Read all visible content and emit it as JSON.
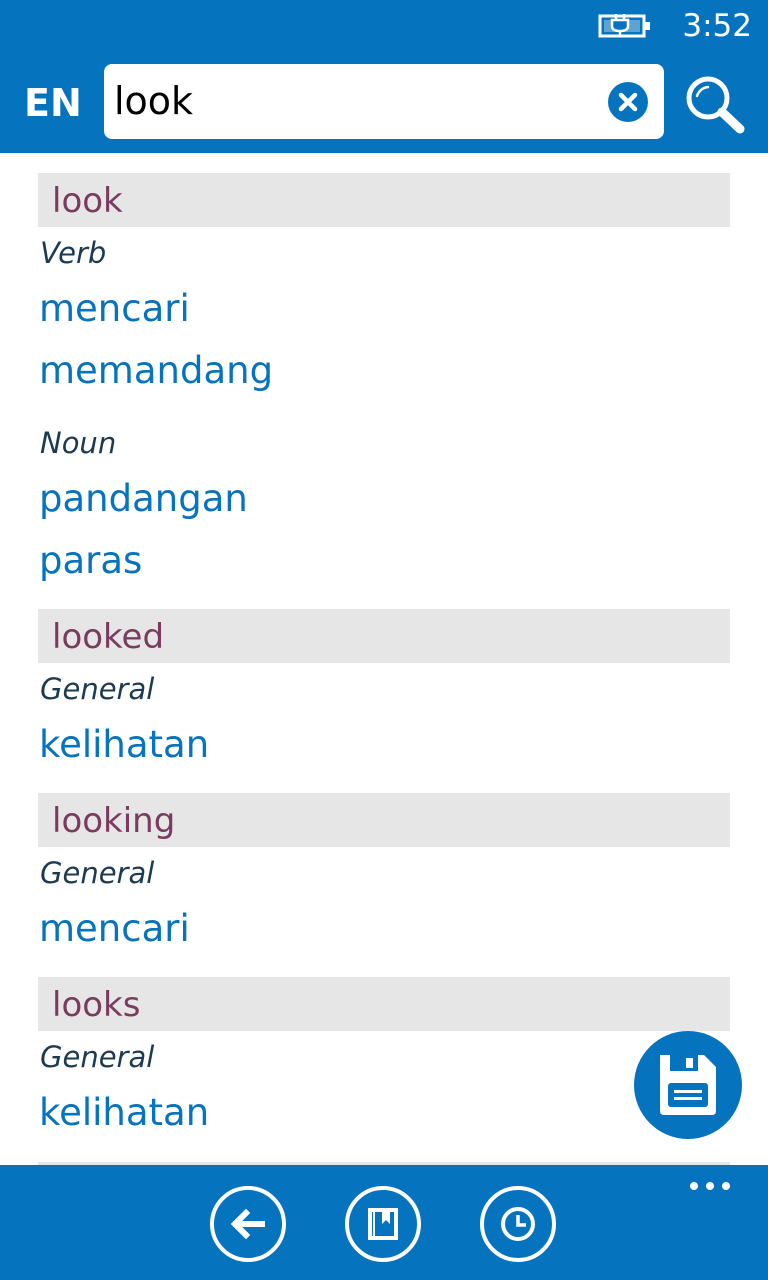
{
  "status_bar": {
    "time": "3:52",
    "battery_icon": "battery-charging-icon"
  },
  "header": {
    "language": "EN",
    "search": {
      "value": "look",
      "clear_icon": "clear-icon",
      "search_icon": "search-icon"
    }
  },
  "entries": [
    {
      "word": "look",
      "groups": [
        {
          "pos": "Verb",
          "translations": [
            "mencari",
            "memandang"
          ]
        },
        {
          "pos": "Noun",
          "translations": [
            "pandangan",
            "paras"
          ]
        }
      ]
    },
    {
      "word": "looked",
      "groups": [
        {
          "pos": "General",
          "translations": [
            "kelihatan"
          ]
        }
      ]
    },
    {
      "word": "looking",
      "groups": [
        {
          "pos": "General",
          "translations": [
            "mencari"
          ]
        }
      ]
    },
    {
      "word": "looks",
      "groups": [
        {
          "pos": "General",
          "translations": [
            "kelihatan"
          ]
        }
      ]
    }
  ],
  "fab": {
    "icon": "save-icon"
  },
  "app_bar": {
    "buttons": [
      {
        "icon": "back-arrow-icon"
      },
      {
        "icon": "bookmark-book-icon"
      },
      {
        "icon": "history-clock-icon"
      }
    ],
    "more_icon": "more-dots-icon"
  },
  "colors": {
    "accent": "#0673be",
    "headword": "#7a3b5e",
    "pos_text": "#1c3a52",
    "entry_header_bg": "#e6e6e6"
  }
}
